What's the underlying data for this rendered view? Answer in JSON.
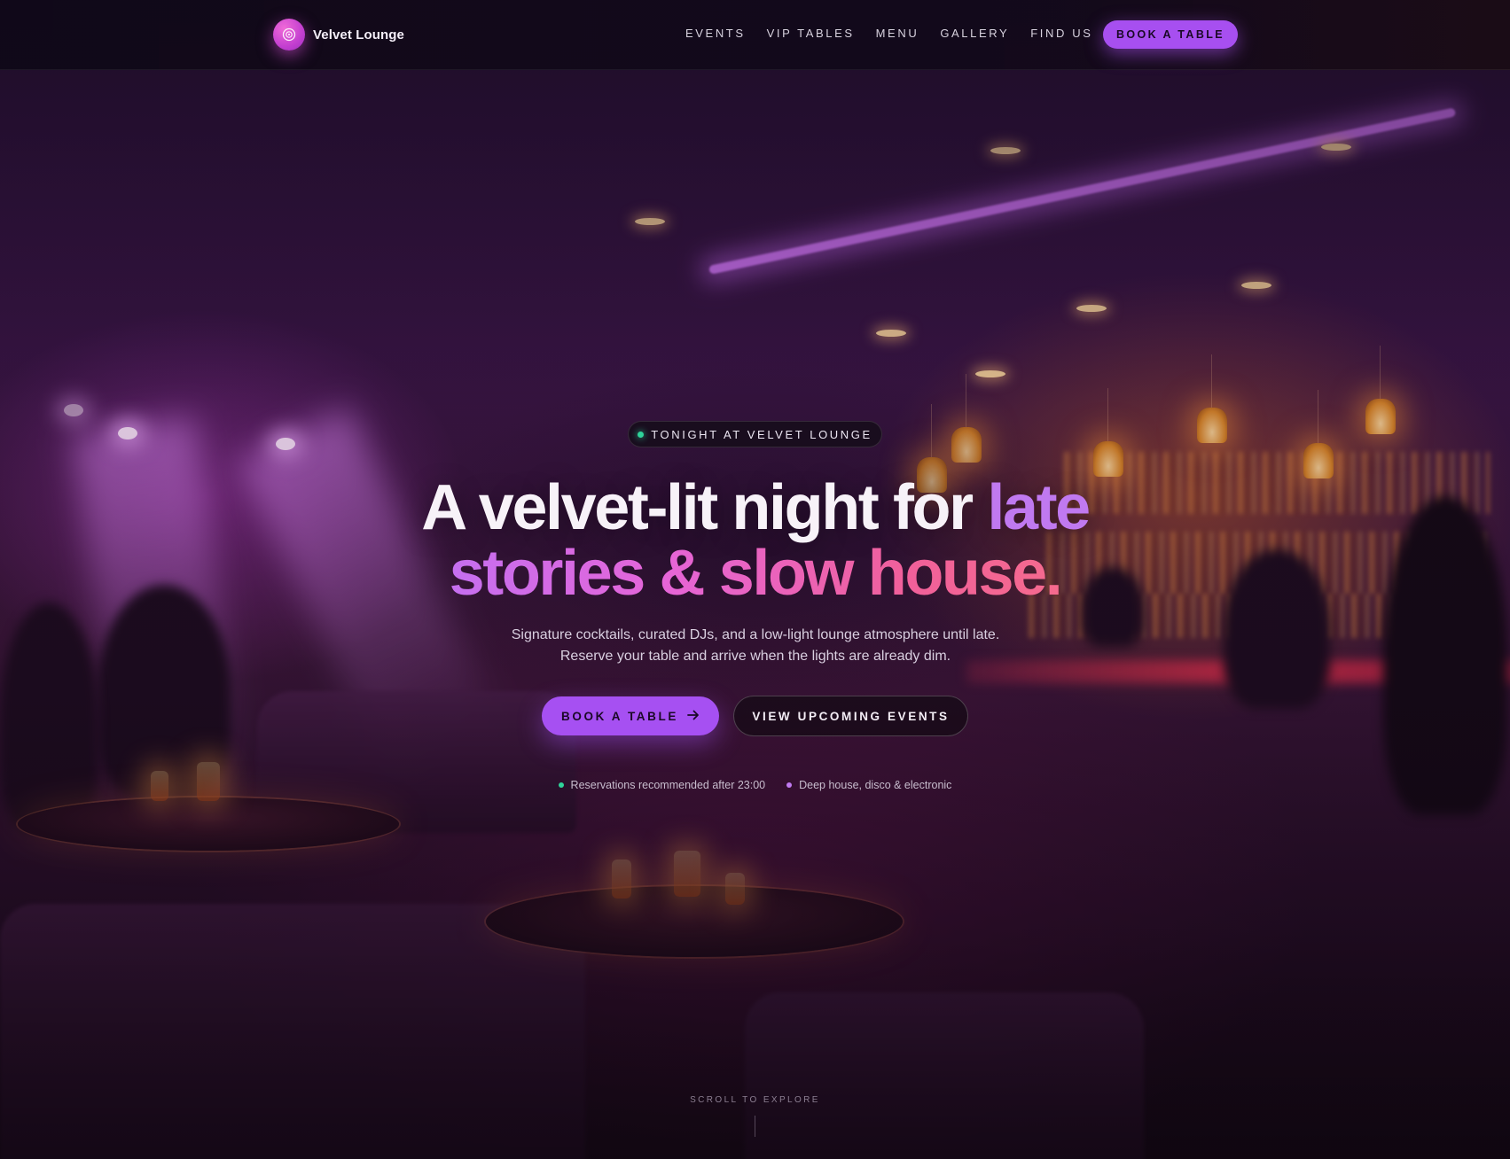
{
  "brand": {
    "name": "Velvet Lounge",
    "logo_icon": "vinyl-disc-icon"
  },
  "nav": {
    "links": [
      "EVENTS",
      "VIP TABLES",
      "MENU",
      "GALLERY",
      "FIND US"
    ],
    "cta_label": "BOOK A TABLE"
  },
  "hero": {
    "badge": "TONIGHT AT VELVET LOUNGE",
    "headline": {
      "part1": "A velvet-lit night for ",
      "part2": "late",
      "part3": "stories & slow house."
    },
    "subtext_line1": "Signature cocktails, curated DJs, and a low-light lounge atmosphere until late.",
    "subtext_line2": "Reserve your table and arrive when the lights are already dim.",
    "primary_button": "BOOK A TABLE",
    "primary_button_icon": "arrow-right-icon",
    "secondary_button": "VIEW UPCOMING EVENTS",
    "notes": [
      {
        "text": "Reservations recommended after 23:00",
        "dot_color": "#2fd39a"
      },
      {
        "text": "Deep house, disco & electronic",
        "dot_color": "#c07af0"
      }
    ],
    "scroll_label": "SCROLL TO EXPLORE"
  },
  "colors": {
    "accent": "#a650f2",
    "accent_pink": "#f0609a",
    "status_green": "#2fd39a",
    "background": "#140a1c"
  }
}
